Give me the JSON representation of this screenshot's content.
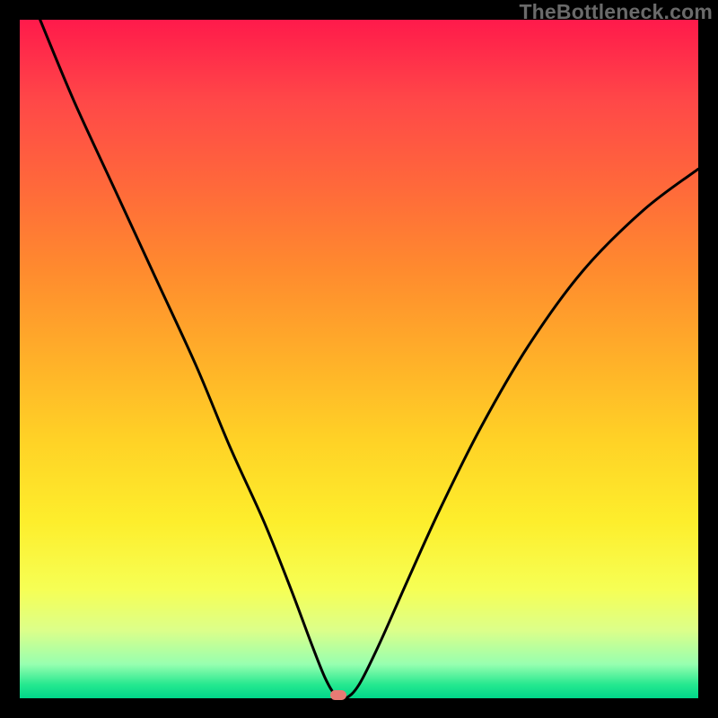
{
  "watermark": "TheBottleneck.com",
  "chart_data": {
    "type": "line",
    "title": "",
    "xlabel": "",
    "ylabel": "",
    "xlim": [
      0,
      100
    ],
    "ylim": [
      0,
      100
    ],
    "grid": false,
    "legend": false,
    "series": [
      {
        "name": "curve",
        "x": [
          3,
          8,
          14,
          20,
          26,
          31,
          36,
          40,
          43,
          45,
          46.5,
          48,
          50,
          53,
          57,
          62,
          68,
          75,
          83,
          92,
          100
        ],
        "values": [
          100,
          88,
          75,
          62,
          49,
          37,
          26,
          16,
          8,
          3,
          0.5,
          0,
          2,
          8,
          17,
          28,
          40,
          52,
          63,
          72,
          78
        ]
      }
    ],
    "marker": {
      "x": 47,
      "y": 0.5
    },
    "gradient_stops": [
      {
        "pos": 0,
        "color": "#ff1a4b"
      },
      {
        "pos": 50,
        "color": "#ffd226"
      },
      {
        "pos": 84,
        "color": "#f6ff55"
      },
      {
        "pos": 100,
        "color": "#00d68a"
      }
    ]
  }
}
